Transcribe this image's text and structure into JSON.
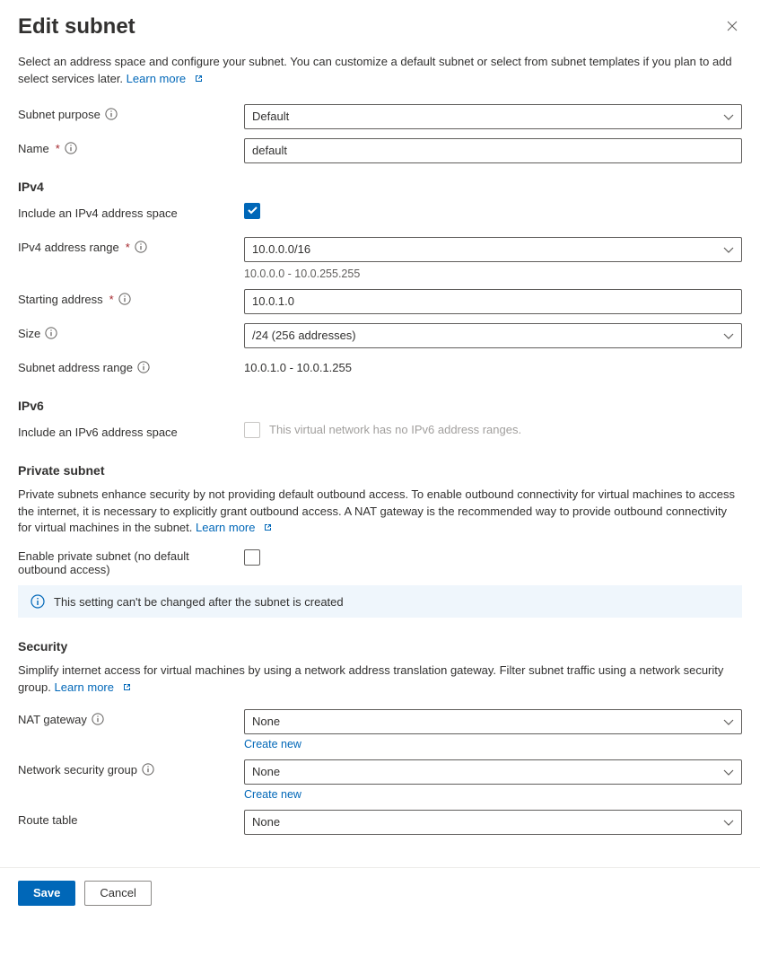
{
  "header": {
    "title": "Edit subnet",
    "description": "Select an address space and configure your subnet. You can customize a default subnet or select from subnet templates if you plan to add select services later.",
    "learn_more": "Learn more"
  },
  "basic": {
    "purpose_label": "Subnet purpose",
    "purpose_value": "Default",
    "name_label": "Name",
    "name_value": "default"
  },
  "ipv4": {
    "heading": "IPv4",
    "include_label": "Include an IPv4 address space",
    "include_checked": true,
    "range_label": "IPv4 address range",
    "range_value": "10.0.0.0/16",
    "range_helper": "10.0.0.0 - 10.0.255.255",
    "start_label": "Starting address",
    "start_value": "10.0.1.0",
    "size_label": "Size",
    "size_value": "/24 (256 addresses)",
    "subnet_range_label": "Subnet address range",
    "subnet_range_value": "10.0.1.0 - 10.0.1.255"
  },
  "ipv6": {
    "heading": "IPv6",
    "include_label": "Include an IPv6 address space",
    "disabled_text": "This virtual network has no IPv6 address ranges."
  },
  "private": {
    "heading": "Private subnet",
    "description": "Private subnets enhance security by not providing default outbound access. To enable outbound connectivity for virtual machines to access the internet, it is necessary to explicitly grant outbound access. A NAT gateway is the recommended way to provide outbound connectivity for virtual machines in the subnet.",
    "learn_more": "Learn more",
    "enable_label": "Enable private subnet (no default outbound access)",
    "banner": "This setting can't be changed after the subnet is created"
  },
  "security": {
    "heading": "Security",
    "description": "Simplify internet access for virtual machines by using a network address translation gateway. Filter subnet traffic using a network security group.",
    "learn_more": "Learn more",
    "nat_label": "NAT gateway",
    "nat_value": "None",
    "nat_create": "Create new",
    "nsg_label": "Network security group",
    "nsg_value": "None",
    "nsg_create": "Create new",
    "route_label": "Route table",
    "route_value": "None"
  },
  "footer": {
    "save": "Save",
    "cancel": "Cancel"
  }
}
